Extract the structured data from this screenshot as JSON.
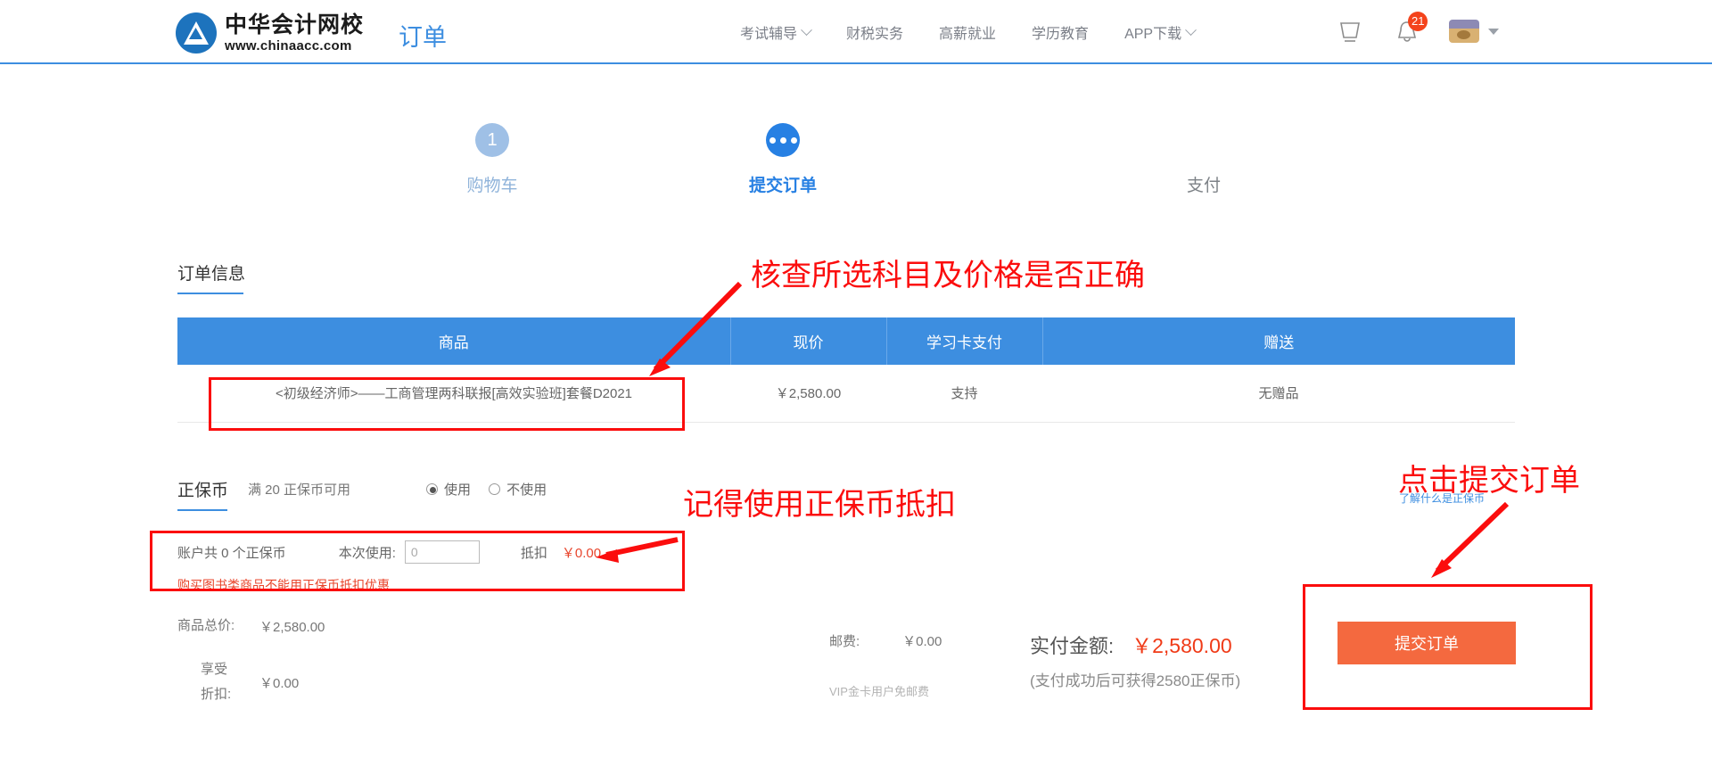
{
  "header": {
    "logo_cn": "中华会计网校",
    "logo_en": "www.chinaacc.com",
    "page_title": "订单",
    "nav": [
      {
        "label": "考试辅导",
        "has_chevron": true
      },
      {
        "label": "财税实务",
        "has_chevron": false
      },
      {
        "label": "高薪就业",
        "has_chevron": false
      },
      {
        "label": "学历教育",
        "has_chevron": false
      },
      {
        "label": "APP下载",
        "has_chevron": true
      }
    ],
    "cart_icon": "cart-icon",
    "bell_icon": "bell-icon",
    "notification_count": "21",
    "avatar_icon": "avatar"
  },
  "steps": [
    {
      "label": "购物车",
      "marker": "1",
      "state": "done"
    },
    {
      "label": "提交订单",
      "marker": "dots",
      "state": "active"
    },
    {
      "label": "支付",
      "marker": "",
      "state": "todo"
    }
  ],
  "order": {
    "section_title": "订单信息",
    "columns": [
      "商品",
      "现价",
      "学习卡支付",
      "赠送"
    ],
    "rows": [
      {
        "product": "<初级经济师>——工商管理两科联报[高效实验班]套餐D2021",
        "price": "￥2,580.00",
        "card_pay": "支持",
        "gift": "无赠品"
      }
    ]
  },
  "coin": {
    "title": "正保币",
    "rule": "满 20 正保币可用",
    "radio_use": "使用",
    "radio_not_use": "不使用",
    "account_text": "账户共 0 个正保币",
    "use_label": "本次使用:",
    "use_value": "0",
    "use_placeholder": "0",
    "deduct_label": "抵扣",
    "deduct_value": "￥0.00",
    "note": "购买图书类商品不能用正保币抵扣优惠",
    "link": "了解什么是正保币"
  },
  "totals": {
    "goods_total_label": "商品总价:",
    "goods_total_value": "￥2,580.00",
    "discount_label": "享受折扣:",
    "discount_value": "￥0.00",
    "shipping_label": "邮费:",
    "shipping_value": "￥0.00",
    "shipping_note": "VIP金卡用户免邮费",
    "pay_label": "实付金额:",
    "pay_value": "￥2,580.00",
    "pay_sub": "(支付成功后可获得2580正保币)",
    "submit_label": "提交订单"
  },
  "annotations": [
    {
      "text": "核查所选科目及价格是否正确"
    },
    {
      "text": "记得使用正保币抵扣"
    },
    {
      "text": "点击提交订单"
    }
  ],
  "colors": {
    "brand_blue": "#3d8ee0",
    "accent_orange": "#f4693f",
    "annotation_red": "#fb0d0d",
    "price_red": "#f03a17"
  }
}
